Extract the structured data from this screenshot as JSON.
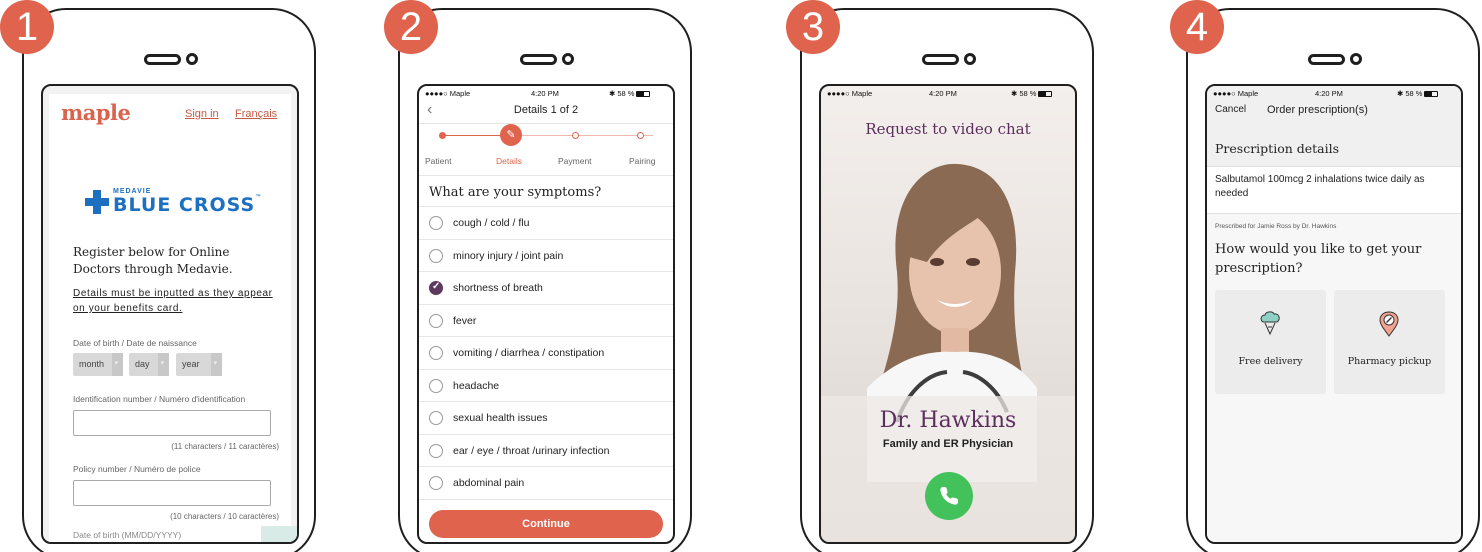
{
  "accent_color": "#e0644d",
  "steps": [
    "1",
    "2",
    "3",
    "4"
  ],
  "screen1": {
    "logo": "maple",
    "sign_in": "Sign in",
    "francais": "Français",
    "insurer_small": "MEDAVIE",
    "insurer_big": "BLUE CROSS",
    "insurer_tm": "™",
    "register_text": "Register below for Online Doctors through Medavie.",
    "details_note": "Details must be inputted as they appear on your benefits card.",
    "dob_label": "Date of birth / Date de naissance",
    "month": "month",
    "day": "day",
    "year": "year",
    "id_label": "Identification number / Numéro d'identification",
    "id_hint": "(11 characters / 11 caractères)",
    "policy_label": "Policy number / Numéro de police",
    "policy_hint": "(10 characters / 10 caractères)",
    "dob2_label": "Date of birth (MM/DD/YYYY)"
  },
  "status": {
    "carrier": "●●●●○ Maple",
    "time": "4:20 PM",
    "battery": "58 %"
  },
  "screen2": {
    "title": "Details 1 of 2",
    "step_labels": [
      "Patient",
      "Details",
      "Payment",
      "Pairing"
    ],
    "question": "What are your symptoms?",
    "options": [
      {
        "label": "cough / cold / flu",
        "checked": false
      },
      {
        "label": "minory injury / joint pain",
        "checked": false
      },
      {
        "label": "shortness of breath",
        "checked": true
      },
      {
        "label": "fever",
        "checked": false
      },
      {
        "label": "vomiting / diarrhea / constipation",
        "checked": false
      },
      {
        "label": "headache",
        "checked": false
      },
      {
        "label": "sexual health issues",
        "checked": false
      },
      {
        "label": "ear / eye / throat /urinary infection",
        "checked": false
      },
      {
        "label": "abdominal pain",
        "checked": false
      }
    ],
    "continue": "Continue"
  },
  "screen3": {
    "title": "Request to video chat",
    "doctor": "Dr. Hawkins",
    "role": "Family and ER Physician"
  },
  "screen4": {
    "cancel": "Cancel",
    "title": "Order prescription(s)",
    "section": "Prescription details",
    "prescription": "Salbutamol 100mcg 2 inhalations twice daily as needed",
    "prescribed_for": "Prescribed for Jamie Ross by Dr. Hawkins",
    "question": "How would you like to get your prescription?",
    "option1": "Free delivery",
    "option2": "Pharmacy pickup"
  }
}
